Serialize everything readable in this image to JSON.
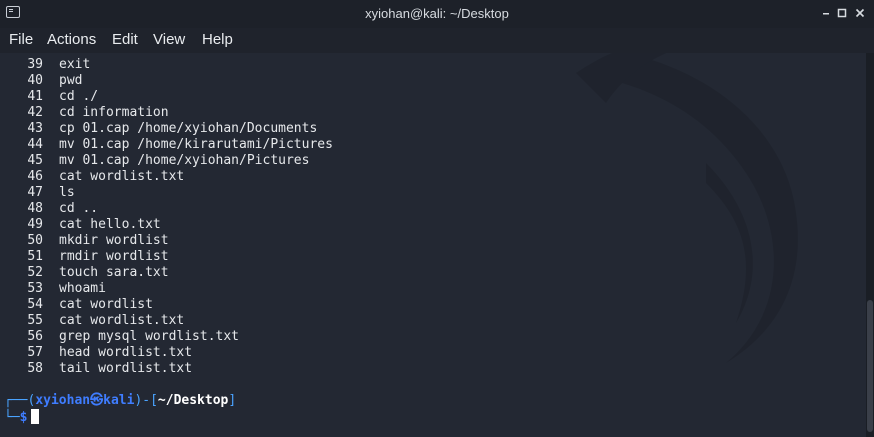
{
  "window": {
    "title": "xyiohan@kali: ~/Desktop",
    "controls": [
      "minimize",
      "maximize",
      "close"
    ]
  },
  "menu": [
    "File",
    "Actions",
    "Edit",
    "View",
    "Help"
  ],
  "history": [
    {
      "n": "39",
      "cmd": "exit"
    },
    {
      "n": "40",
      "cmd": "pwd"
    },
    {
      "n": "41",
      "cmd": "cd ./"
    },
    {
      "n": "42",
      "cmd": "cd information"
    },
    {
      "n": "43",
      "cmd": "cp 01.cap /home/xyiohan/Documents"
    },
    {
      "n": "44",
      "cmd": "mv 01.cap /home/kirarutami/Pictures"
    },
    {
      "n": "45",
      "cmd": "mv 01.cap /home/xyiohan/Pictures"
    },
    {
      "n": "46",
      "cmd": "cat wordlist.txt"
    },
    {
      "n": "47",
      "cmd": "ls"
    },
    {
      "n": "48",
      "cmd": "cd .."
    },
    {
      "n": "49",
      "cmd": "cat hello.txt"
    },
    {
      "n": "50",
      "cmd": "mkdir wordlist"
    },
    {
      "n": "51",
      "cmd": "rmdir wordlist"
    },
    {
      "n": "52",
      "cmd": "touch sara.txt"
    },
    {
      "n": "53",
      "cmd": "whoami"
    },
    {
      "n": "54",
      "cmd": "cat wordlist"
    },
    {
      "n": "55",
      "cmd": "cat wordlist.txt"
    },
    {
      "n": "56",
      "cmd": "grep mysql wordlist.txt"
    },
    {
      "n": "57",
      "cmd": "head wordlist.txt"
    },
    {
      "n": "58",
      "cmd": "tail wordlist.txt"
    }
  ],
  "prompt": {
    "user": "xyiohan",
    "at": "㉿",
    "host": "kali",
    "cwd": "~/Desktop",
    "symbol": "$"
  },
  "colors": {
    "background": "#232833",
    "prompt_frame": "#4aa3ff",
    "prompt_user": "#3f7dff",
    "text": "#e6e8eb"
  }
}
